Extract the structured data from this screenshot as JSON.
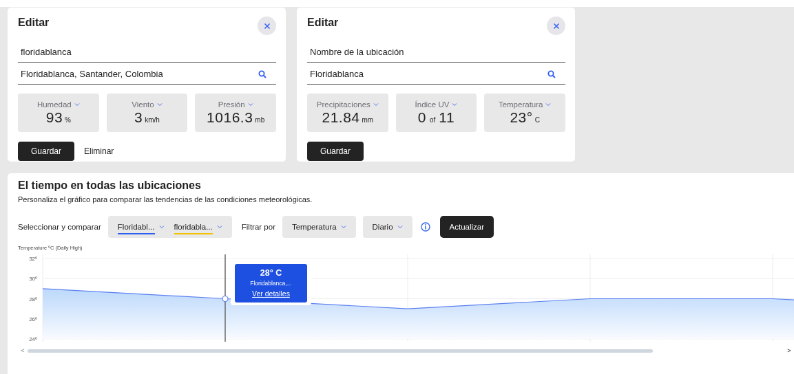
{
  "edit_cards": [
    {
      "title": "Editar",
      "name_field": {
        "value": "floridablanca"
      },
      "search_field": {
        "value": "Floridablanca, Santander, Colombia"
      },
      "metrics": [
        {
          "kind": "value",
          "label": "Humedad",
          "value": "93",
          "unit": "%"
        },
        {
          "kind": "value",
          "label": "Viento",
          "value": "3",
          "unit": "km/h"
        },
        {
          "kind": "value",
          "label": "Presión",
          "value": "1016.3",
          "unit": "mb"
        }
      ],
      "buttons": [
        {
          "kind": "primary",
          "label": "Guardar"
        },
        {
          "kind": "text",
          "label": "Eliminar"
        }
      ]
    },
    {
      "title": "Editar",
      "name_field": {
        "placeholder": "Nombre de la ubicación"
      },
      "search_field": {
        "value": "Floridablanca"
      },
      "metrics": [
        {
          "kind": "value",
          "label": "Precipitaciones",
          "value": "21.84",
          "unit": "mm"
        },
        {
          "kind": "ratio",
          "label": "Índice UV",
          "value": "0",
          "unit": "of",
          "total": "11"
        },
        {
          "kind": "value",
          "label": "Temperatura",
          "value": "23°",
          "unit": "C"
        }
      ],
      "buttons": [
        {
          "kind": "primary",
          "label": "Guardar"
        }
      ]
    }
  ],
  "comparison": {
    "title": "El tiempo en todas las ubicaciones",
    "subtitle": "Personaliza el gráfico para comparar las tendencias de las condiciones meteorológicas.",
    "compare_label": "Seleccionar y comparar",
    "locations": [
      {
        "label": "Floridabl...",
        "color": "#2f5ff0"
      },
      {
        "label": "floridabla...",
        "color": "#f2c200"
      }
    ],
    "filter_label": "Filtrar por",
    "filters": [
      {
        "label": "Temperatura"
      },
      {
        "label": "Diario"
      }
    ],
    "update_button": "Actualizar",
    "chart": {
      "axis_title": "Temperature ºC (Daily High)",
      "y_ticks": [
        "32º",
        "30º",
        "28º",
        "26º",
        "24º"
      ]
    },
    "tooltip": {
      "reading": "28° C",
      "location": "Floridablanca,...",
      "link": "Ver detalles"
    },
    "scroll_left": "<",
    "scroll_right": ">"
  }
}
